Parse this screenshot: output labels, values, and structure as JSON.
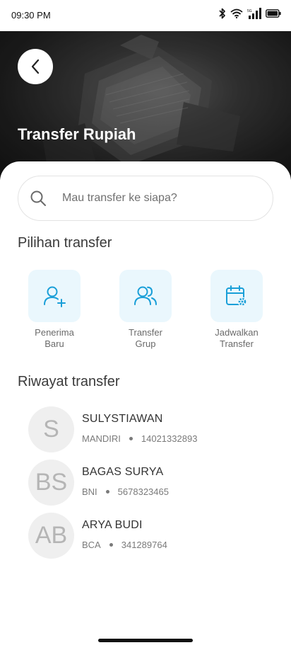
{
  "status_bar": {
    "time": "09:30 PM",
    "network": "5G"
  },
  "header": {
    "title": "Transfer Rupiah",
    "back_icon": "chevron-left-icon"
  },
  "search": {
    "placeholder": "Mau transfer ke siapa?",
    "icon": "search-icon"
  },
  "transfer_options": {
    "title": "Pilihan transfer",
    "accent_color": "#1a9fd8",
    "tile_color": "#eaf7fd",
    "items": [
      {
        "line1": "Penerima",
        "line2": "Baru",
        "icon": "user-add-icon"
      },
      {
        "line1": "Transfer",
        "line2": "Grup",
        "icon": "users-group-icon"
      },
      {
        "line1": "Jadwalkan",
        "line2": "Transfer",
        "icon": "calendar-settings-icon"
      }
    ]
  },
  "history": {
    "title": "Riwayat transfer",
    "items": [
      {
        "initials": "S",
        "name": "SULYSTIAWAN",
        "bank": "MANDIRI",
        "account": "14021332893"
      },
      {
        "initials": "BS",
        "name": "BAGAS SURYA",
        "bank": "BNI",
        "account": "5678323465"
      },
      {
        "initials": "AB",
        "name": "ARYA BUDI",
        "bank": "BCA",
        "account": "341289764"
      }
    ]
  }
}
